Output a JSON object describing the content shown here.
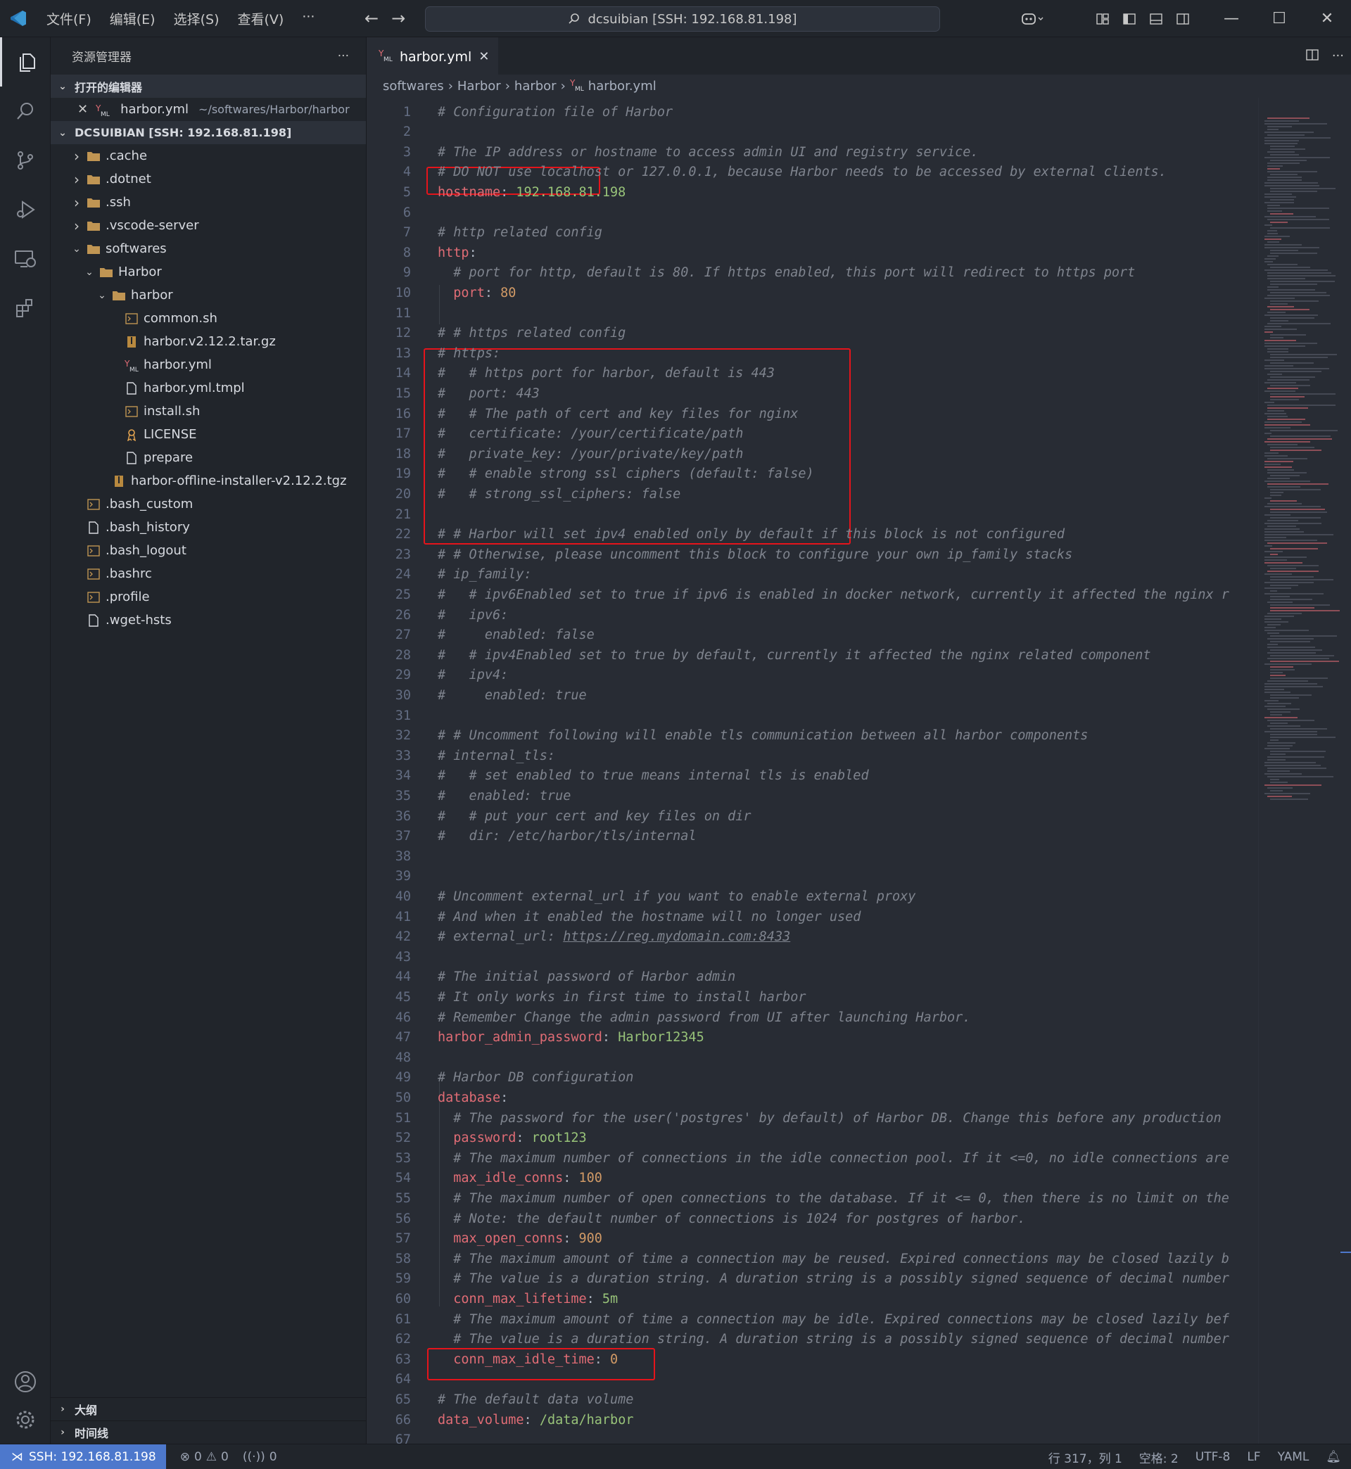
{
  "window": {
    "menu": [
      "文件(F)",
      "编辑(E)",
      "选择(S)",
      "查看(V)",
      "···"
    ],
    "search_text": "dcsuibian [SSH: 192.168.81.198]"
  },
  "sidebar": {
    "title": "资源管理器",
    "more": "···",
    "open_editors_label": "打开的编辑器",
    "open_editor": {
      "name": "harbor.yml",
      "path": "~/softwares/Harbor/harbor"
    },
    "workspace_label": "DCSUIBIAN [SSH: 192.168.81.198]",
    "tree": [
      {
        "name": ".cache",
        "type": "folder",
        "depth": 0,
        "expanded": false
      },
      {
        "name": ".dotnet",
        "type": "folder",
        "depth": 0,
        "expanded": false
      },
      {
        "name": ".ssh",
        "type": "folder",
        "depth": 0,
        "expanded": false
      },
      {
        "name": ".vscode-server",
        "type": "folder",
        "depth": 0,
        "expanded": false
      },
      {
        "name": "softwares",
        "type": "folder",
        "depth": 0,
        "expanded": true
      },
      {
        "name": "Harbor",
        "type": "folder",
        "depth": 1,
        "expanded": true
      },
      {
        "name": "harbor",
        "type": "folder",
        "depth": 2,
        "expanded": true
      },
      {
        "name": "common.sh",
        "type": "shell",
        "depth": 3
      },
      {
        "name": "harbor.v2.12.2.tar.gz",
        "type": "archive",
        "depth": 3
      },
      {
        "name": "harbor.yml",
        "type": "yaml",
        "depth": 3
      },
      {
        "name": "harbor.yml.tmpl",
        "type": "file",
        "depth": 3
      },
      {
        "name": "install.sh",
        "type": "shell",
        "depth": 3
      },
      {
        "name": "LICENSE",
        "type": "license",
        "depth": 3
      },
      {
        "name": "prepare",
        "type": "file",
        "depth": 3
      },
      {
        "name": "harbor-offline-installer-v2.12.2.tgz",
        "type": "archive",
        "depth": 2
      },
      {
        "name": ".bash_custom",
        "type": "shell",
        "depth": 0
      },
      {
        "name": ".bash_history",
        "type": "file",
        "depth": 0
      },
      {
        "name": ".bash_logout",
        "type": "shell",
        "depth": 0
      },
      {
        "name": ".bashrc",
        "type": "shell",
        "depth": 0
      },
      {
        "name": ".profile",
        "type": "shell",
        "depth": 0
      },
      {
        "name": ".wget-hsts",
        "type": "file",
        "depth": 0
      }
    ],
    "outline_label": "大纲",
    "timeline_label": "时间线"
  },
  "editor": {
    "tab_label": "harbor.yml",
    "breadcrumbs": [
      "softwares",
      "Harbor",
      "harbor",
      "harbor.yml"
    ],
    "lines": [
      [
        [
          "c",
          "# Configuration file of Harbor"
        ]
      ],
      [],
      [
        [
          "c",
          "# The IP address or hostname to access admin UI and registry service."
        ]
      ],
      [
        [
          "c",
          "# DO NOT use localhost or 127.0.0.1, because Harbor needs to be accessed by external clients."
        ]
      ],
      [
        [
          "k",
          "hostname"
        ],
        [
          "p",
          ": "
        ],
        [
          "s",
          "192.168.81.198"
        ]
      ],
      [],
      [
        [
          "c",
          "# http related config"
        ]
      ],
      [
        [
          "k",
          "http"
        ],
        [
          "p",
          ":"
        ]
      ],
      [
        [
          "i",
          "  "
        ],
        [
          "c",
          "# port for http, default is 80. If https enabled, this port will redirect to https port"
        ]
      ],
      [
        [
          "i",
          "  "
        ],
        [
          "k",
          "port"
        ],
        [
          "p",
          ": "
        ],
        [
          "n",
          "80"
        ]
      ],
      [],
      [
        [
          "c",
          "# # https related config"
        ]
      ],
      [
        [
          "c",
          "# https:"
        ]
      ],
      [
        [
          "c",
          "#   # https port for harbor, default is 443"
        ]
      ],
      [
        [
          "c",
          "#   port: 443"
        ]
      ],
      [
        [
          "c",
          "#   # The path of cert and key files for nginx"
        ]
      ],
      [
        [
          "c",
          "#   certificate: /your/certificate/path"
        ]
      ],
      [
        [
          "c",
          "#   private_key: /your/private/key/path"
        ]
      ],
      [
        [
          "c",
          "#   # enable strong ssl ciphers (default: false)"
        ]
      ],
      [
        [
          "c",
          "#   # strong_ssl_ciphers: false"
        ]
      ],
      [],
      [
        [
          "c",
          "# # Harbor will set ipv4 enabled only by default if this block is not configured"
        ]
      ],
      [
        [
          "c",
          "# # Otherwise, please uncomment this block to configure your own ip_family stacks"
        ]
      ],
      [
        [
          "c",
          "# ip_family:"
        ]
      ],
      [
        [
          "c",
          "#   # ipv6Enabled set to true if ipv6 is enabled in docker network, currently it affected the nginx r"
        ]
      ],
      [
        [
          "c",
          "#   ipv6:"
        ]
      ],
      [
        [
          "c",
          "#     enabled: false"
        ]
      ],
      [
        [
          "c",
          "#   # ipv4Enabled set to true by default, currently it affected the nginx related component"
        ]
      ],
      [
        [
          "c",
          "#   ipv4:"
        ]
      ],
      [
        [
          "c",
          "#     enabled: true"
        ]
      ],
      [],
      [
        [
          "c",
          "# # Uncomment following will enable tls communication between all harbor components"
        ]
      ],
      [
        [
          "c",
          "# internal_tls:"
        ]
      ],
      [
        [
          "c",
          "#   # set enabled to true means internal tls is enabled"
        ]
      ],
      [
        [
          "c",
          "#   enabled: true"
        ]
      ],
      [
        [
          "c",
          "#   # put your cert and key files on dir"
        ]
      ],
      [
        [
          "c",
          "#   dir: /etc/harbor/tls/internal"
        ]
      ],
      [],
      [],
      [
        [
          "c",
          "# Uncomment external_url if you want to enable external proxy"
        ]
      ],
      [
        [
          "c",
          "# And when it enabled the hostname will no longer used"
        ]
      ],
      [
        [
          "c",
          "# external_url: "
        ],
        [
          "cu",
          "https://reg.mydomain.com:8433"
        ]
      ],
      [],
      [
        [
          "c",
          "# The initial password of Harbor admin"
        ]
      ],
      [
        [
          "c",
          "# It only works in first time to install harbor"
        ]
      ],
      [
        [
          "c",
          "# Remember Change the admin password from UI after launching Harbor."
        ]
      ],
      [
        [
          "k",
          "harbor_admin_password"
        ],
        [
          "p",
          ": "
        ],
        [
          "s",
          "Harbor12345"
        ]
      ],
      [],
      [
        [
          "c",
          "# Harbor DB configuration"
        ]
      ],
      [
        [
          "k",
          "database"
        ],
        [
          "p",
          ":"
        ]
      ],
      [
        [
          "i",
          "  "
        ],
        [
          "c",
          "# The password for the user('postgres' by default) of Harbor DB. Change this before any production"
        ]
      ],
      [
        [
          "i",
          "  "
        ],
        [
          "k",
          "password"
        ],
        [
          "p",
          ": "
        ],
        [
          "s",
          "root123"
        ]
      ],
      [
        [
          "i",
          "  "
        ],
        [
          "c",
          "# The maximum number of connections in the idle connection pool. If it <=0, no idle connections are"
        ]
      ],
      [
        [
          "i",
          "  "
        ],
        [
          "k",
          "max_idle_conns"
        ],
        [
          "p",
          ": "
        ],
        [
          "n",
          "100"
        ]
      ],
      [
        [
          "i",
          "  "
        ],
        [
          "c",
          "# The maximum number of open connections to the database. If it <= 0, then there is no limit on the"
        ]
      ],
      [
        [
          "i",
          "  "
        ],
        [
          "c",
          "# Note: the default number of connections is 1024 for postgres of harbor."
        ]
      ],
      [
        [
          "i",
          "  "
        ],
        [
          "k",
          "max_open_conns"
        ],
        [
          "p",
          ": "
        ],
        [
          "n",
          "900"
        ]
      ],
      [
        [
          "i",
          "  "
        ],
        [
          "c",
          "# The maximum amount of time a connection may be reused. Expired connections may be closed lazily b"
        ]
      ],
      [
        [
          "i",
          "  "
        ],
        [
          "c",
          "# The value is a duration string. A duration string is a possibly signed sequence of decimal number"
        ]
      ],
      [
        [
          "i",
          "  "
        ],
        [
          "k",
          "conn_max_lifetime"
        ],
        [
          "p",
          ": "
        ],
        [
          "s",
          "5m"
        ]
      ],
      [
        [
          "i",
          "  "
        ],
        [
          "c",
          "# The maximum amount of time a connection may be idle. Expired connections may be closed lazily bef"
        ]
      ],
      [
        [
          "i",
          "  "
        ],
        [
          "c",
          "# The value is a duration string. A duration string is a possibly signed sequence of decimal number"
        ]
      ],
      [
        [
          "i",
          "  "
        ],
        [
          "k",
          "conn_max_idle_time"
        ],
        [
          "p",
          ": "
        ],
        [
          "n",
          "0"
        ]
      ],
      [],
      [
        [
          "c",
          "# The default data volume"
        ]
      ],
      [
        [
          "k",
          "data_volume"
        ],
        [
          "p",
          ": "
        ],
        [
          "s",
          "/data/harbor"
        ]
      ],
      []
    ]
  },
  "statusbar": {
    "remote": "SSH: 192.168.81.198",
    "errors": "0",
    "warnings": "0",
    "ports": "0",
    "position": "行 317，列 1",
    "indent": "空格: 2",
    "encoding": "UTF-8",
    "eol": "LF",
    "language": "YAML"
  },
  "colors": {
    "accent": "#4d78cc",
    "highlight_box": "#e5141b",
    "comment": "#7f848e",
    "key": "#e06c75",
    "string": "#98c379",
    "number": "#d19a66"
  }
}
